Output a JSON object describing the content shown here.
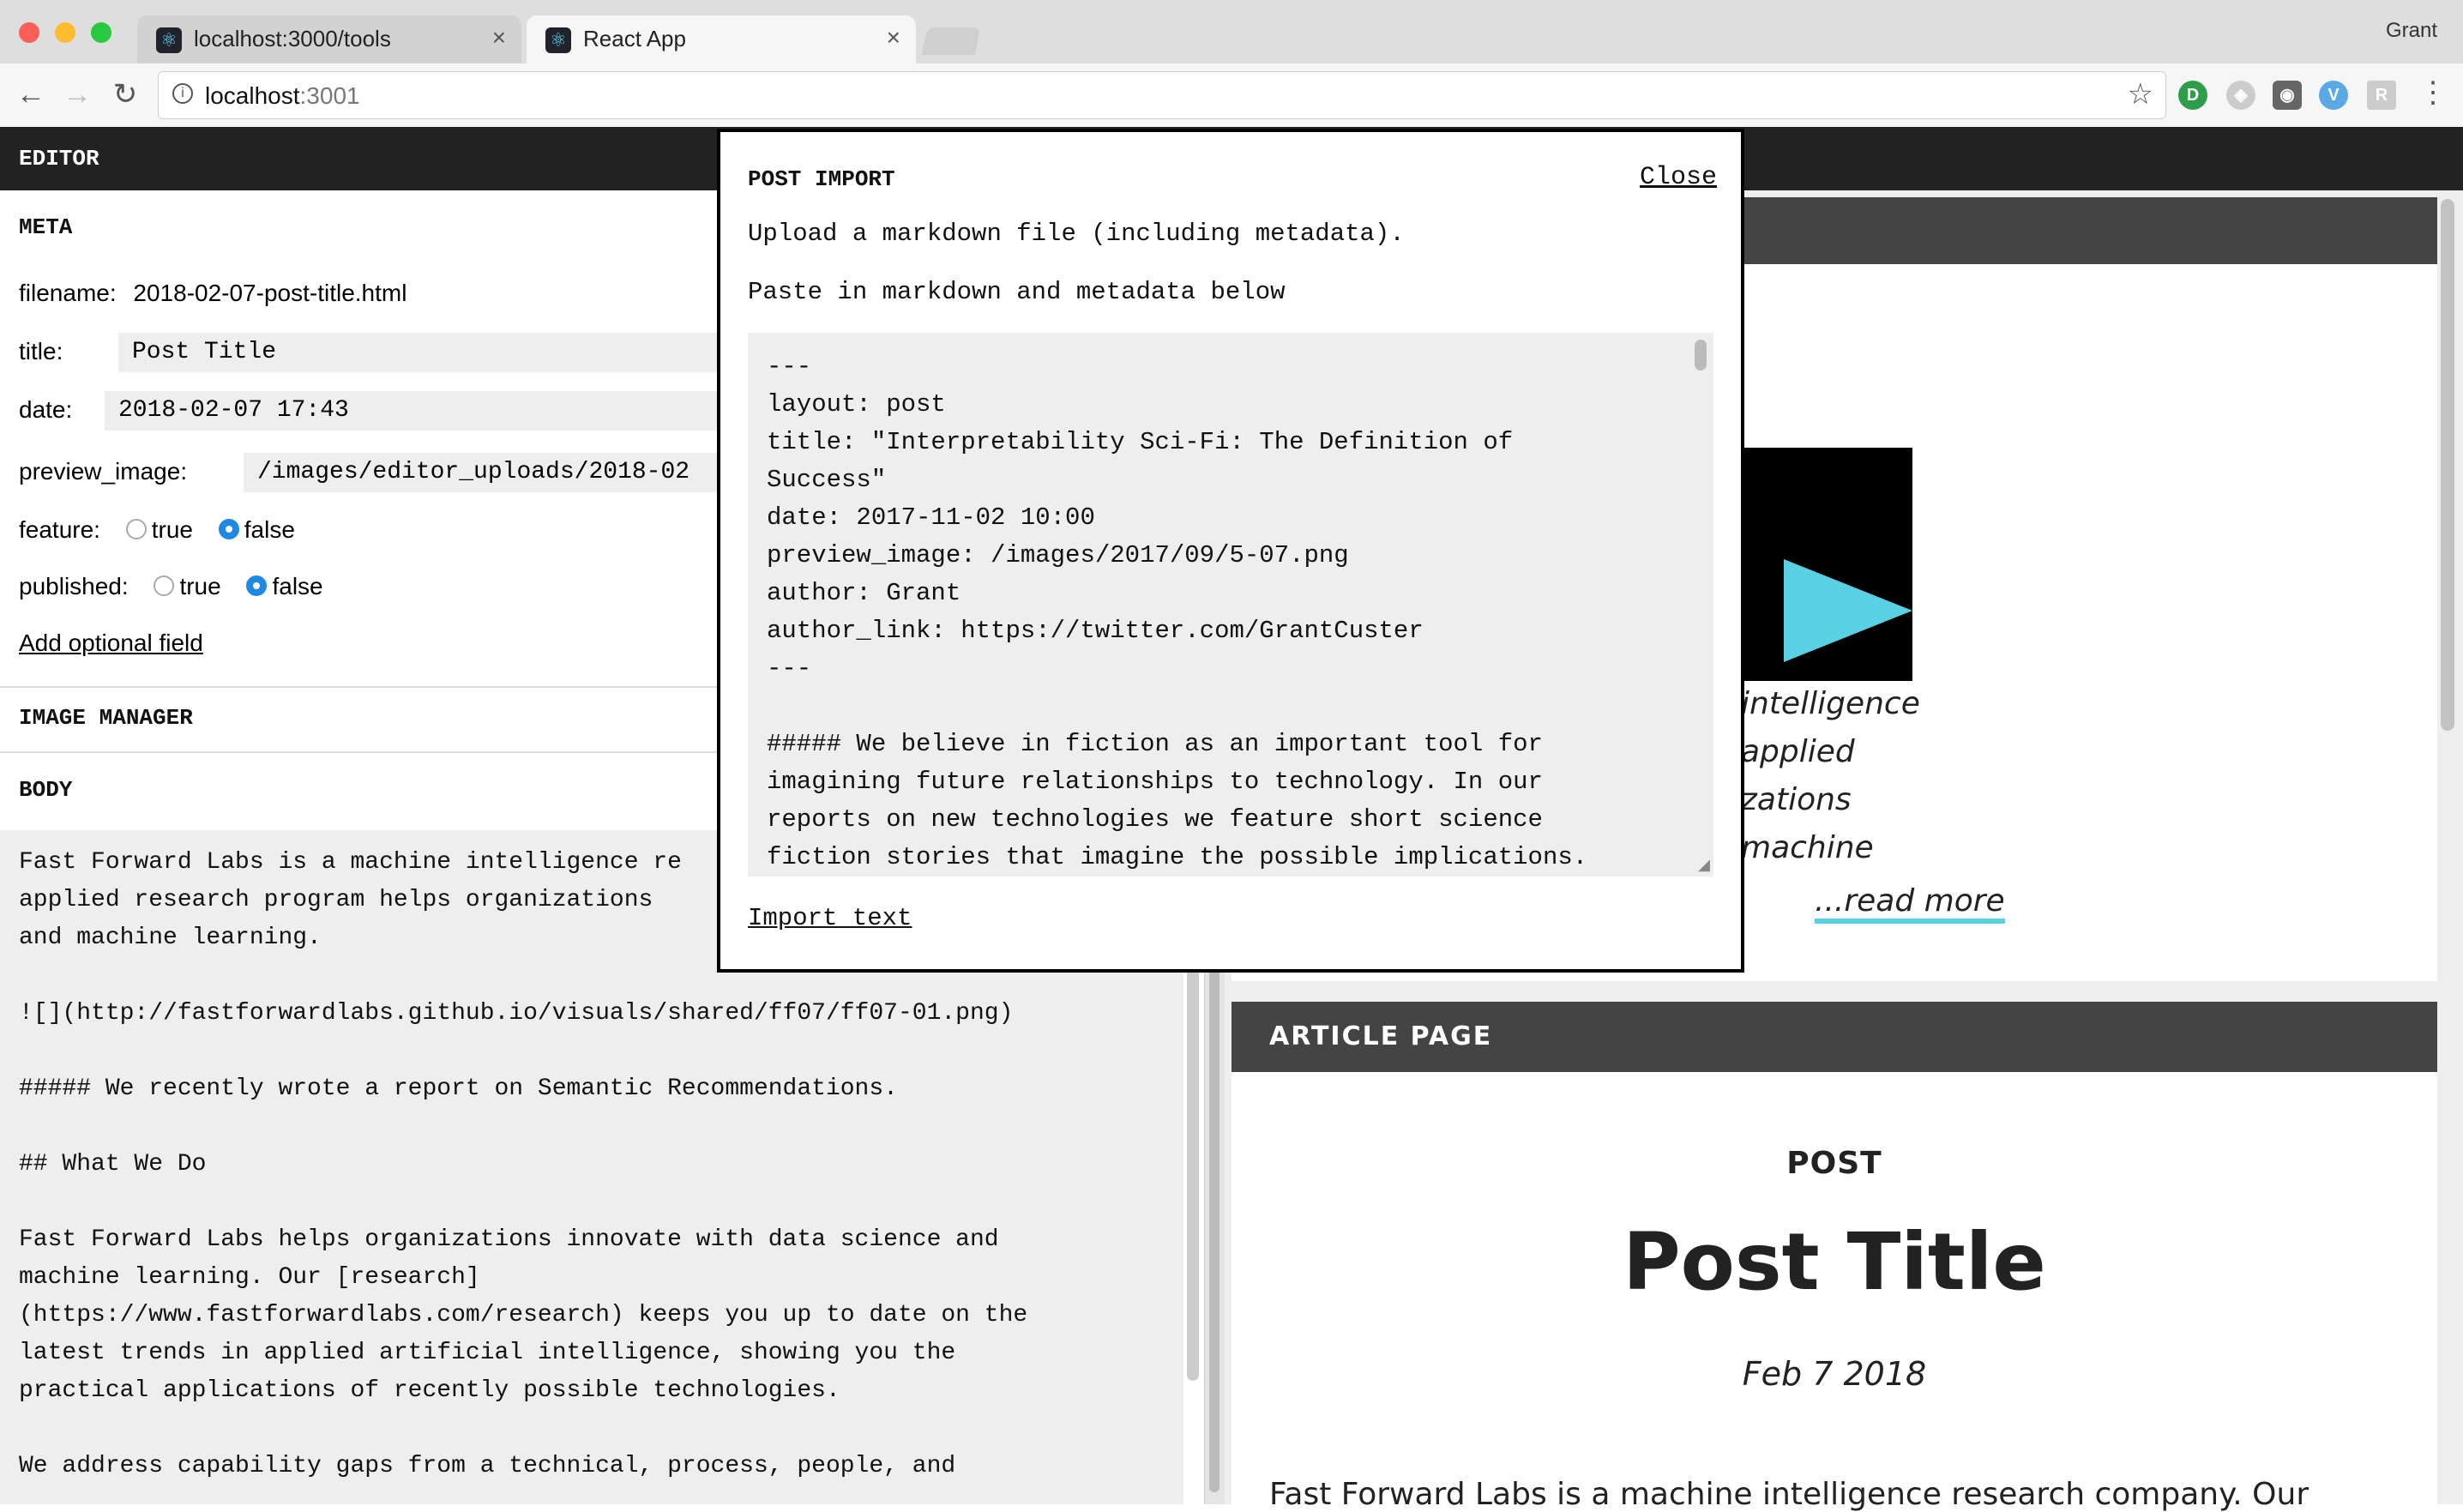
{
  "browser": {
    "tabs": [
      {
        "title": "localhost:3000/tools"
      },
      {
        "title": "React App"
      }
    ],
    "user": "Grant",
    "url_host": "localhost",
    "url_port": ":3001"
  },
  "editor": {
    "label": "EDITOR",
    "meta_heading": "META",
    "filename_label": "filename:",
    "filename_value": "2018-02-07-post-title.html",
    "title_label": "title:",
    "title_value": "Post Title",
    "date_label": "date:",
    "date_value": "2018-02-07 17:43",
    "preview_image_label": "preview_image:",
    "preview_image_value": "/images/editor_uploads/2018-02",
    "feature_label": "feature:",
    "published_label": "published:",
    "true_label": "true",
    "false_label": "false",
    "add_optional_field": "Add optional field",
    "image_manager_heading": "IMAGE MANAGER",
    "body_heading": "BODY",
    "body_text": "Fast Forward Labs is a machine intelligence re\napplied research program helps organizations \nand machine learning.\n\n![](http://fastforwardlabs.github.io/visuals/shared/ff07/ff07-01.png)\n\n##### We recently wrote a report on Semantic Recommendations.\n\n## What We Do\n\nFast Forward Labs helps organizations innovate with data science and\nmachine learning. Our [research]\n(https://www.fastforwardlabs.com/research) keeps you up to date on the\nlatest trends in applied artificial intelligence, showing you the\npractical applications of recently possible technologies.\n\nWe address capability gaps from a technical, process, people, and"
  },
  "preview": {
    "excerpt_lines": [
      "intelligence",
      "applied",
      "zations",
      "machine"
    ],
    "read_more": "...read more",
    "article_page_label": "ARTICLE PAGE",
    "post_kicker": "POST",
    "post_title": "Post Title",
    "post_date": "Feb 7 2018",
    "article_body_start": "Fast Forward Labs is a machine intelligence research company. Our"
  },
  "modal": {
    "title": "POST IMPORT",
    "close": "Close",
    "upload_text": "Upload a markdown file (including metadata).",
    "paste_text": "Paste in markdown and metadata below",
    "textarea_value": "---\nlayout: post\ntitle: \"Interpretability Sci-Fi: The Definition of\nSuccess\"\ndate: 2017-11-02 10:00\npreview_image: /images/2017/09/5-07.png\nauthor: Grant\nauthor_link: https://twitter.com/GrantCuster\n---\n\n##### We believe in fiction as an important tool for\nimagining future relationships to technology. In our\nreports on new technologies we feature short science\nfiction stories that imagine the possible implications.",
    "import_text": "Import text"
  },
  "colors": {
    "dark_bar": "#222222",
    "preview_bar": "#444444",
    "radio_selected": "#1e88e5",
    "accent_cyan": "#5ad1e3"
  }
}
